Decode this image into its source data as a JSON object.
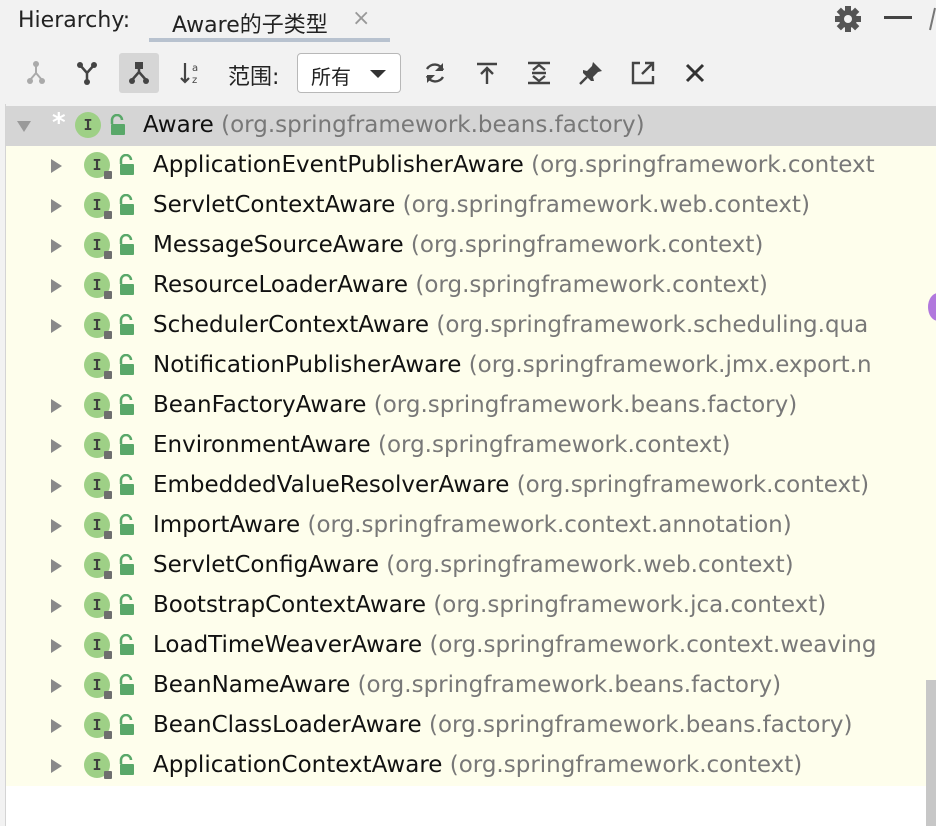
{
  "header": {
    "panel_title": "Hierarchy:",
    "tab_label": "Aware的子类型",
    "tab_close": "×",
    "icons": [
      "gear-icon",
      "minimize-icon"
    ]
  },
  "toolbar": {
    "scope_label": "范围:",
    "scope_value": "所有",
    "icons": [
      "type-hierarchy-icon",
      "supertypes-icon",
      "subtypes-icon",
      "sort-alphabetically-icon",
      "refresh-icon",
      "export-icon",
      "expand-all-icon",
      "pin-icon",
      "open-in-new-tab-icon",
      "close-icon"
    ]
  },
  "colors": {
    "tree_background": "#fefeec",
    "selected_row": "#d5d5d5",
    "interface_icon": "#9ed086",
    "lock_icon": "#59a869",
    "package_text": "#787878"
  },
  "tree": {
    "root": {
      "name": "Aware",
      "package": "(org.springframework.beans.factory)",
      "marker": "*",
      "expanded": true,
      "selected": true
    },
    "children": [
      {
        "name": "ApplicationEventPublisherAware",
        "package": "(org.springframework.context",
        "expandable": true
      },
      {
        "name": "ServletContextAware",
        "package": "(org.springframework.web.context)",
        "expandable": true
      },
      {
        "name": "MessageSourceAware",
        "package": "(org.springframework.context)",
        "expandable": true
      },
      {
        "name": "ResourceLoaderAware",
        "package": "(org.springframework.context)",
        "expandable": true
      },
      {
        "name": "SchedulerContextAware",
        "package": "(org.springframework.scheduling.qua",
        "expandable": true
      },
      {
        "name": "NotificationPublisherAware",
        "package": "(org.springframework.jmx.export.n",
        "expandable": false
      },
      {
        "name": "BeanFactoryAware",
        "package": "(org.springframework.beans.factory)",
        "expandable": true
      },
      {
        "name": "EnvironmentAware",
        "package": "(org.springframework.context)",
        "expandable": true
      },
      {
        "name": "EmbeddedValueResolverAware",
        "package": "(org.springframework.context)",
        "expandable": true
      },
      {
        "name": "ImportAware",
        "package": "(org.springframework.context.annotation)",
        "expandable": true
      },
      {
        "name": "ServletConfigAware",
        "package": "(org.springframework.web.context)",
        "expandable": true
      },
      {
        "name": "BootstrapContextAware",
        "package": "(org.springframework.jca.context)",
        "expandable": true
      },
      {
        "name": "LoadTimeWeaverAware",
        "package": "(org.springframework.context.weaving",
        "expandable": true
      },
      {
        "name": "BeanNameAware",
        "package": "(org.springframework.beans.factory)",
        "expandable": true
      },
      {
        "name": "BeanClassLoaderAware",
        "package": "(org.springframework.beans.factory)",
        "expandable": true
      },
      {
        "name": "ApplicationContextAware",
        "package": "(org.springframework.context)",
        "expandable": true
      }
    ]
  }
}
